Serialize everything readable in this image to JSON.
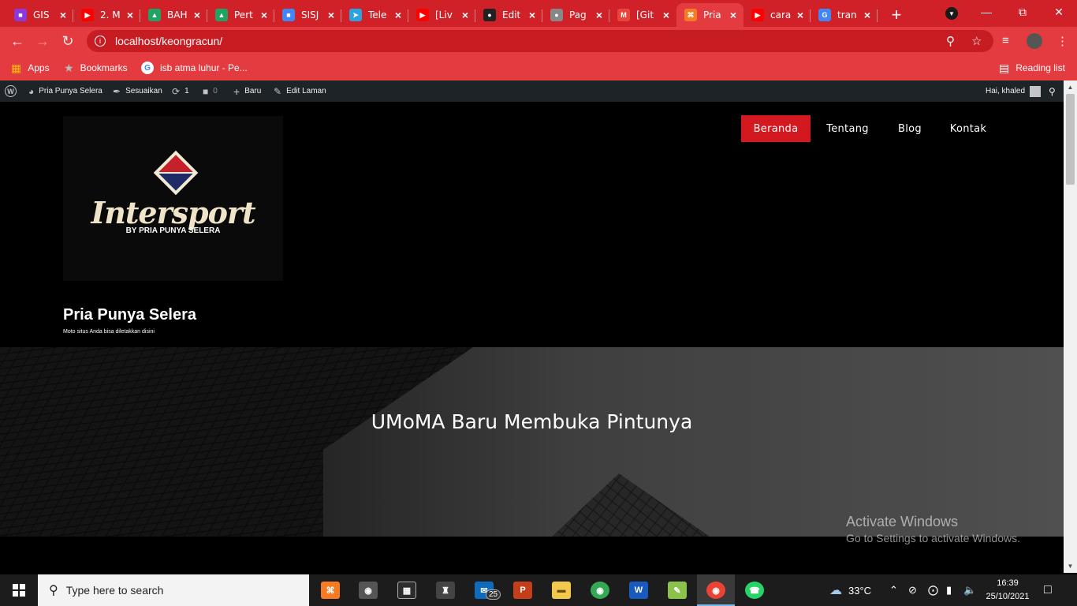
{
  "browser": {
    "tabs": [
      {
        "title": "GIS",
        "color": "#8b3ad9",
        "glyph": "■"
      },
      {
        "title": "2. M",
        "color": "#ff0000",
        "glyph": "▶"
      },
      {
        "title": "BAH",
        "color": "#1fa463",
        "glyph": "▲"
      },
      {
        "title": "Pert",
        "color": "#1fa463",
        "glyph": "▲"
      },
      {
        "title": "SISJ",
        "color": "#4285f4",
        "glyph": "■"
      },
      {
        "title": "Tele",
        "color": "#2aa3de",
        "glyph": "➤"
      },
      {
        "title": "[Liv",
        "color": "#ff0000",
        "glyph": "▶"
      },
      {
        "title": "Edit",
        "color": "#222222",
        "glyph": "●"
      },
      {
        "title": "Pag",
        "color": "#888888",
        "glyph": "●"
      },
      {
        "title": "[Git",
        "color": "#e8463c",
        "glyph": "M"
      },
      {
        "title": "Pria",
        "color": "#f77b23",
        "glyph": "⌘"
      },
      {
        "title": "cara",
        "color": "#ff0000",
        "glyph": "▶"
      },
      {
        "title": "tran",
        "color": "#4285f4",
        "glyph": "G"
      }
    ],
    "active_tab_index": 10,
    "new_tab_label": "+",
    "url": "localhost/keongracun/",
    "bookmarks": {
      "apps": "Apps",
      "bookmarks": "Bookmarks",
      "isb": "isb atma luhur - Pe...",
      "reading_list": "Reading list"
    },
    "accent": "#e33b3f"
  },
  "wp_admin_bar": {
    "site_name": "Pria Punya Selera",
    "customize": "Sesuaikan",
    "updates_count": "1",
    "comments_count": "0",
    "new": "Baru",
    "edit": "Edit Laman",
    "greeting": "Hai, khaled"
  },
  "site": {
    "logo": {
      "brand": "Intersport",
      "byline": "BY PRIA PUNYA SELERA"
    },
    "title": "Pria Punya Selera",
    "tagline": "Moto situs Anda bisa diletakkan disini",
    "menu": [
      "Beranda",
      "Tentang",
      "Blog",
      "Kontak"
    ],
    "active_menu": "Beranda",
    "hero_title": "UMoMA Baru Membuka Pintunya"
  },
  "watermark": {
    "title": "Activate Windows",
    "subtitle": "Go to Settings to activate Windows."
  },
  "taskbar": {
    "search_placeholder": "Type here to search",
    "mail_badge": "25",
    "weather": "33°C",
    "time": "16:39",
    "date": "25/10/2021"
  }
}
